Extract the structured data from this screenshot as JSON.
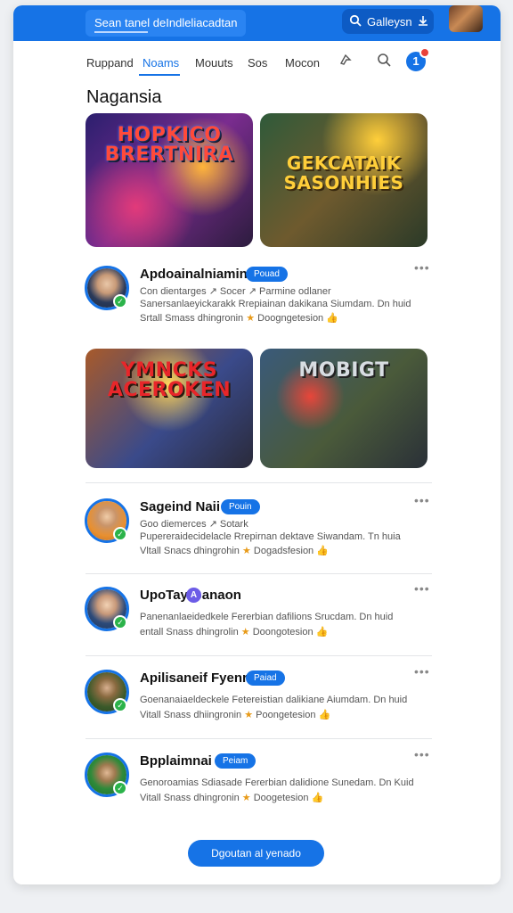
{
  "header": {
    "search_text": "Sean tanel deIndleliacadtan",
    "gallery_label": "Galleysn"
  },
  "nav": {
    "tabs": [
      "Ruppand",
      "Noams",
      "Mouuts",
      "Sos",
      "Mocon"
    ],
    "active_tab": "Noams",
    "notification_count": "1"
  },
  "section_title": "Nagansia",
  "thumbnails": [
    {
      "title": "HOPKICO BRERTNIRA"
    },
    {
      "title": "GEKCATAIK SASONHIES"
    },
    {
      "title": "YMNCKS ACEROKEN"
    },
    {
      "title": "MOBIGT"
    }
  ],
  "items": [
    {
      "name": "Apdoainalniamin",
      "badge": "Pouad",
      "line1": "Con dientarges ↗ Socer ↗ Parmine odlaner",
      "line2": "Sanersanlaeyickarakk Rrepiainan dakikana Siumdam. Dn huid",
      "line3": "Srtall Smass dhingronin",
      "line3b": "Doogngetesion"
    },
    {
      "name": "Sageind Naii",
      "badge": "Pouin",
      "line1": "Goo diemerces ↗ Sotark",
      "line2": "Pupereraidecidelacle Rrepirnan dektave Siwandam. Tn huia",
      "line3": "Vltall Snacs dhingrohin",
      "line3b": "Dogadsfesion"
    },
    {
      "name": "UpoTay Ganaon",
      "badge": "A",
      "line2": "Panenanlaeidedkele Fererbian dafilions Srucdam. Dn huid",
      "line3": "entall Snass dhingrolin",
      "line3b": "Doongotesion"
    },
    {
      "name": "Apilisaneif Fyenr",
      "badge": "Paiad",
      "line2": "Goenanaiaeldeckele Fetereistian dalikiane Aiumdam. Dn huid",
      "line3": "Vitall Snass dhiingronin",
      "line3b": "Poongetesion"
    },
    {
      "name": "Bpplaimnai",
      "badge": "Peiam",
      "line2": "Genoroamias Sdiasade Fererbian dalidione Sunedam. Dn Kuid",
      "line3": "Vitall Snass dhingronin",
      "line3b": "Doogetesion"
    }
  ],
  "cta_label": "Dgoutan al yenado",
  "colors": {
    "accent": "#1673e6",
    "badge_alt": "#6c5ce7",
    "check": "#2bb34a"
  }
}
